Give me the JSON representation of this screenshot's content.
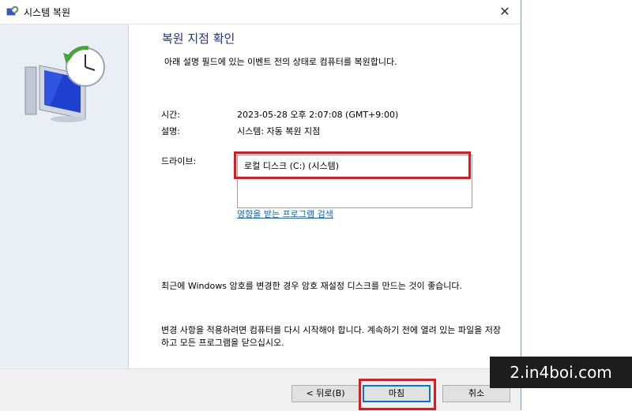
{
  "window": {
    "title": "시스템 복원",
    "close_glyph": "✕"
  },
  "main": {
    "heading": "복원 지점 확인",
    "subtitle": "아래 설명 필드에 있는 이벤트 전의 상태로 컴퓨터를 복원합니다.",
    "time_label": "시간:",
    "time_value": "2023-05-28 오후 2:07:08 (GMT+9:00)",
    "desc_label": "설명:",
    "desc_value": "시스템: 자동 복원 지점",
    "drive_label": "드라이브:",
    "drive_item": "로컬 디스크 (C:) (시스템)",
    "affected_link": "영향을 받는 프로그램 검색",
    "password_note": "최근에 Windows 암호를 변경한 경우 암호 재설정 디스크를 만드는 것이 좋습니다.",
    "restart_note": "변경 사항을 적용하려면 컴퓨터를 다시 시작해야 합니다. 계속하기 전에 열려 있는 파일을 저장하고 모든 프로그램을 닫으십시오."
  },
  "footer": {
    "back_label": "< 뒤로(B)",
    "finish_label": "마침",
    "cancel_label": "취소"
  },
  "watermark": {
    "text": "2.in4boi.com"
  },
  "colors": {
    "heading": "#1e3287",
    "highlight": "#e3181f",
    "link": "#0066cc"
  },
  "icons": {
    "title_icon": "system-restore-icon",
    "side_art": "system-restore-monitor-clock-icon"
  }
}
